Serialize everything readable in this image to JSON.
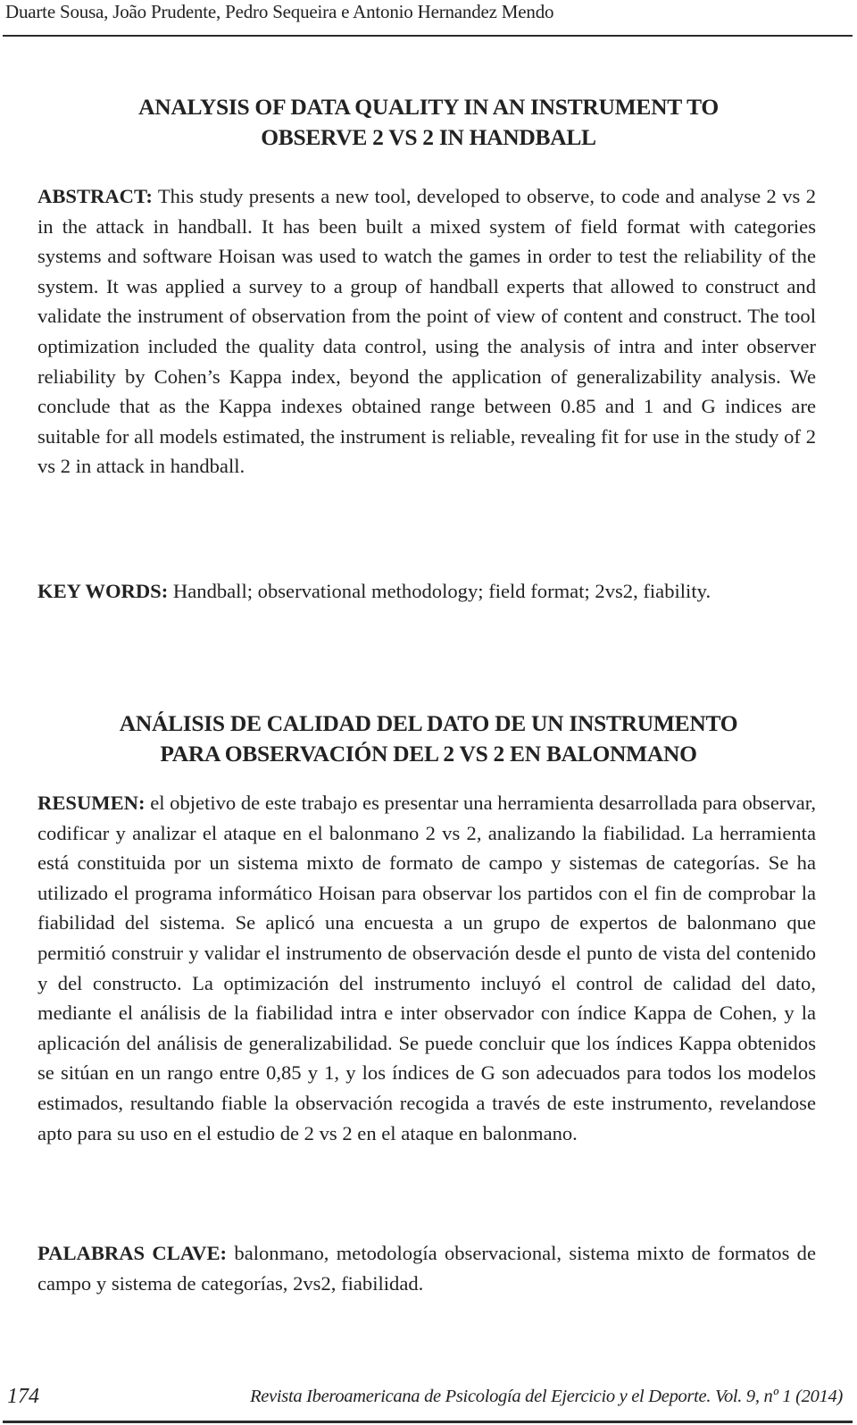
{
  "running_head": "Duarte Sousa, João Prudente, Pedro Sequeira e Antonio Hernandez Mendo",
  "english": {
    "title_line1": "ANALYSIS OF DATA QUALITY IN AN INSTRUMENT TO",
    "title_line2": "OBSERVE 2 VS 2 IN HANDBALL",
    "abstract_label": "ABSTRACT:",
    "abstract_text": "This study presents a new tool, developed to observe, to code and analyse 2 vs 2 in the attack in handball. It has been built a mixed system of field format with categories systems and software Hoisan was used to watch the games in order to test the reliability of the system. It was applied a survey to a group of handball experts that allowed to construct and validate the instrument of observation from the point of view of content and construct. The tool optimization included the quality data control, using the analysis of intra and inter observer reliability by Cohen’s Kappa index, beyond the application of generalizability analysis. We conclude that as the Kappa indexes obtained range between 0.85 and 1 and G indices are suitable for all models estimated, the instrument is reliable, revealing fit for use in the study of 2 vs 2 in attack in handball.",
    "keywords_label": "KEY WORDS:",
    "keywords_text": "Handball; observational methodology; field format; 2vs2, fiability."
  },
  "spanish": {
    "title_line1": "ANÁLISIS DE CALIDAD DEL DATO DE UN INSTRUMENTO",
    "title_line2": "PARA OBSERVACIÓN DEL 2 VS 2 EN BALONMANO",
    "resumen_label": "RESUMEN:",
    "resumen_text": "el objetivo de este trabajo es presentar una herramienta desarrollada para observar, codificar y analizar el ataque en el balonmano 2 vs 2, analizando la fiabilidad. La herramienta está constituida por un sistema mixto de formato de campo y sistemas de categorías. Se ha utilizado el programa informático Hoisan para observar los partidos con el fin de comprobar la fiabilidad del sistema. Se aplicó una encuesta a un grupo de expertos de balonmano que permitió construir y validar el instrumento de observación desde el punto de vista del contenido y del constructo. La optimización del instrumento incluyó el control de calidad del dato, mediante el análisis de la fiabilidad intra e inter observador con índice Kappa de Cohen, y la aplicación del análisis de generalizabilidad. Se puede concluir que los índices Kappa obtenidos se sitúan en un rango entre 0,85 y 1, y los índices de G son adecuados para todos los modelos estimados, resultando fiable la observación recogida a través de este instrumento, revelandose apto para su uso en el estudio de 2 vs 2 en el ataque en balonmano.",
    "palabras_label": "PALABRAS CLAVE:",
    "palabras_text": "balonmano, metodología observacional, sistema mixto de formatos de campo y sistema de categorías, 2vs2, fiabilidad."
  },
  "footer": {
    "page_number": "174",
    "journal": "Revista Iberoamericana de Psicología del Ejercicio y el Deporte. Vol. 9, nº 1 (2014)"
  }
}
